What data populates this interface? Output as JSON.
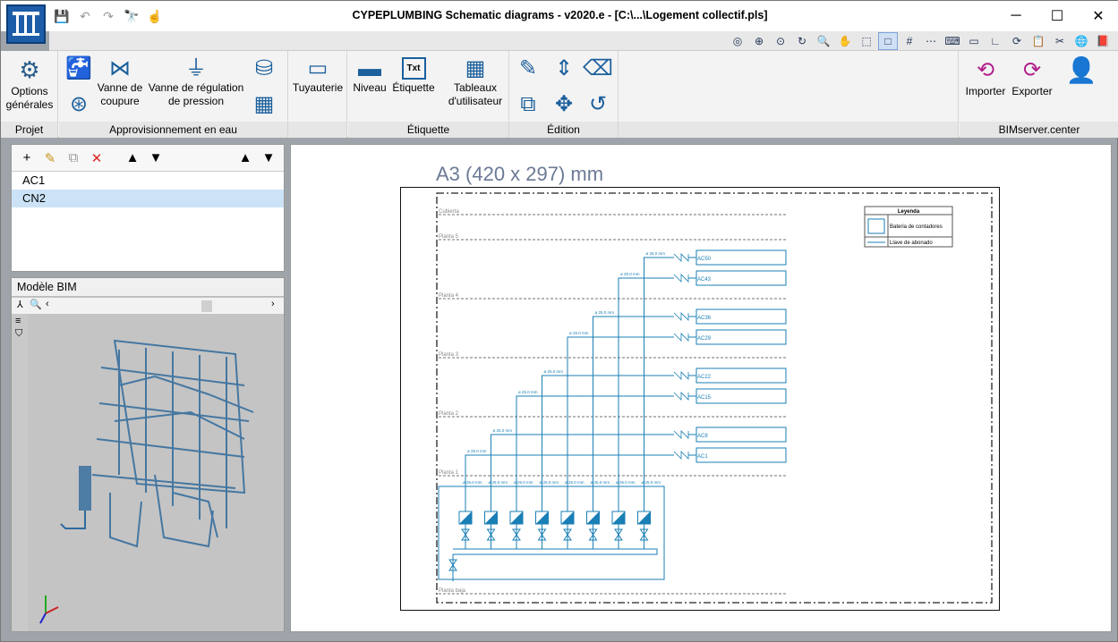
{
  "window": {
    "title": "CYPEPLUMBING Schematic diagrams - v2020.e - [C:\\...\\Logement collectif.pls]"
  },
  "ribbon": {
    "projet": {
      "label": "Projet",
      "options_label": "Options générales"
    },
    "approvisionnement": {
      "label": "Approvisionnement en eau",
      "vanne_coupure": "Vanne de coupure",
      "vanne_regulation": "Vanne de régulation de pression"
    },
    "tuyauterie": "Tuyauterie",
    "etiquette": {
      "label": "Étiquette",
      "niveau": "Niveau",
      "etiquette_btn": "Étiquette",
      "txt_icon": "Txt"
    },
    "tableaux": "Tableaux d'utilisateur",
    "edition": {
      "label": "Édition"
    },
    "bimserver": {
      "label": "BIMserver.center",
      "importer": "Importer",
      "exporter": "Exporter"
    }
  },
  "list": {
    "items": [
      "AC1",
      "CN2"
    ],
    "selected": 1
  },
  "bim": {
    "title": "Modèle BIM"
  },
  "drawing": {
    "sheet_title": "A3 (420 x 297) mm",
    "legend": {
      "title": "Leyenda",
      "battery": "Bateria de contadores",
      "key": "Llave de abonado"
    },
    "levels": [
      "Cubierta",
      "Planta 5",
      "Planta 4",
      "Planta 3",
      "Planta 2",
      "Planta 1",
      "Planta baja"
    ],
    "outlets": [
      "AC50",
      "AC43",
      "AC36",
      "AC29",
      "AC22",
      "AC15",
      "AC8",
      "AC1"
    ],
    "pipe_label": "ø 25.0 mm"
  },
  "colors": {
    "accent": "#1a7fb5",
    "title_blue": "#1d5da8"
  }
}
